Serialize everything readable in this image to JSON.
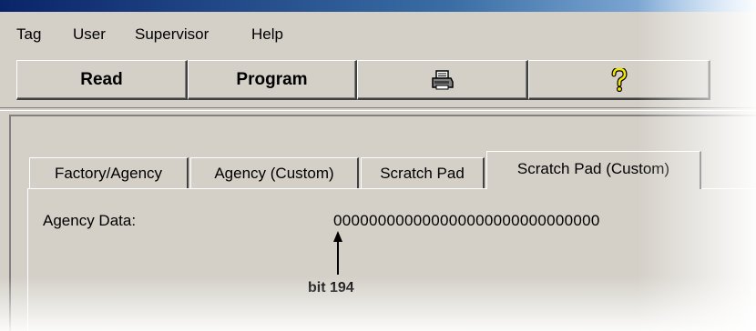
{
  "menu": [
    "Tag",
    "User",
    "Supervisor",
    "Help"
  ],
  "toolbar": {
    "read_label": "Read",
    "program_label": "Program",
    "print_icon": "printer-icon",
    "help_icon": "question-mark-icon"
  },
  "tabs": [
    "Factory/Agency",
    "Agency (Custom)",
    "Scratch Pad",
    "Scratch Pad (Custom)"
  ],
  "active_tab": "Scratch Pad (Custom)",
  "content": {
    "agency_label": "Agency Data:",
    "agency_value": "000000000000000000000000000000",
    "annotation": "bit 194"
  },
  "colors": {
    "window_bg": "#d4d0c8",
    "title_blue": "#0a246a"
  }
}
